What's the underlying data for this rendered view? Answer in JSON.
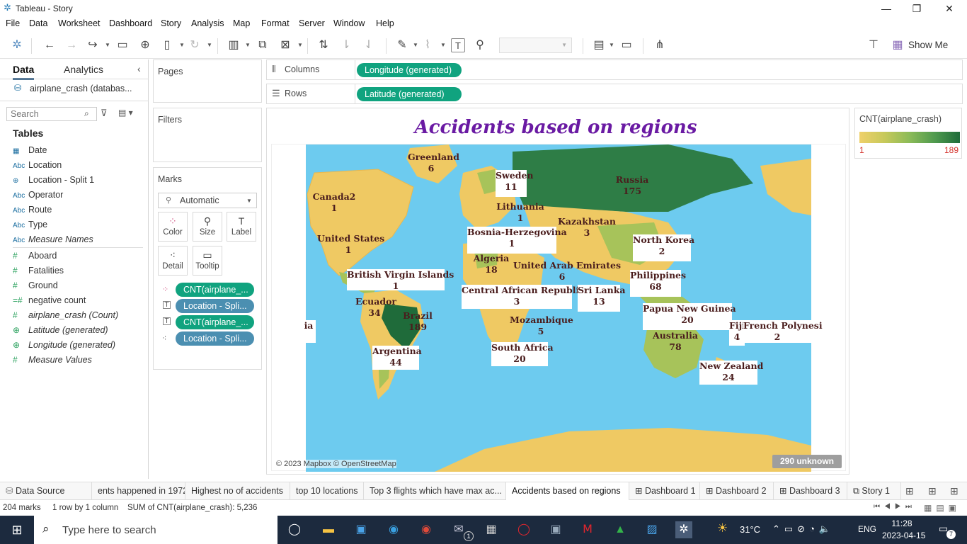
{
  "window": {
    "title": "Tableau - Story",
    "minimize": "—",
    "restore": "❐",
    "close": "✕"
  },
  "menu": [
    "File",
    "Data",
    "Worksheet",
    "Dashboard",
    "Story",
    "Analysis",
    "Map",
    "Format",
    "Server",
    "Window",
    "Help"
  ],
  "toolbar": {
    "show_me": "Show Me"
  },
  "left_pane": {
    "tab_data": "Data",
    "tab_analytics": "Analytics",
    "datasource": "airplane_crash (databas...",
    "search_placeholder": "Search",
    "tables_header": "Tables",
    "fields": [
      {
        "icon": "date",
        "label": "Date",
        "italic": false
      },
      {
        "icon": "Abc",
        "label": "Location",
        "italic": false
      },
      {
        "icon": "geo",
        "label": "Location - Split 1",
        "italic": false
      },
      {
        "icon": "Abc",
        "label": "Operator",
        "italic": false
      },
      {
        "icon": "Abc",
        "label": "Route",
        "italic": false
      },
      {
        "icon": "Abc",
        "label": "Type",
        "italic": false
      },
      {
        "icon": "Abc",
        "label": "Measure Names",
        "italic": true
      },
      {
        "icon": "#",
        "label": "Aboard",
        "italic": false
      },
      {
        "icon": "#",
        "label": "Fatalities",
        "italic": false
      },
      {
        "icon": "#",
        "label": "Ground",
        "italic": false
      },
      {
        "icon": "=#",
        "label": "negative count",
        "italic": false
      },
      {
        "icon": "#",
        "label": "airplane_crash (Count)",
        "italic": true
      },
      {
        "icon": "globe",
        "label": "Latitude (generated)",
        "italic": true
      },
      {
        "icon": "globe",
        "label": "Longitude (generated)",
        "italic": true
      },
      {
        "icon": "#",
        "label": "Measure Values",
        "italic": true
      }
    ]
  },
  "shelves": {
    "pages": "Pages",
    "filters": "Filters",
    "marks": "Marks",
    "mark_type": "Automatic",
    "mark_buttons": [
      "Color",
      "Size",
      "Label",
      "Detail",
      "Tooltip"
    ],
    "mark_pills": [
      "CNT(airplane_...",
      "Location - Spli...",
      "CNT(airplane_...",
      "Location - Spli..."
    ],
    "columns_label": "Columns",
    "rows_label": "Rows",
    "columns_pill": "Longitude (generated)",
    "rows_pill": "Latitude (generated)"
  },
  "view": {
    "title": "Accidents based on regions",
    "copyright": "© 2023 Mapbox © OpenStreetMap",
    "unknown": "290 unknown"
  },
  "map_labels": [
    {
      "name": "Greenland",
      "count": "6"
    },
    {
      "name": "Sweden",
      "count": "11"
    },
    {
      "name": "Russia",
      "count": "175"
    },
    {
      "name": "Canada2",
      "count": "1"
    },
    {
      "name": "Lithuania",
      "count": "1"
    },
    {
      "name": "Kazakhstan",
      "count": "3"
    },
    {
      "name": "Bosnia-Herzegovina",
      "count": "1"
    },
    {
      "name": "North Korea",
      "count": "2"
    },
    {
      "name": "United States",
      "count": "1"
    },
    {
      "name": "Algeria",
      "count": "18"
    },
    {
      "name": "United Arab Emirates",
      "count": "6"
    },
    {
      "name": "British Virgin Islands",
      "count": "1"
    },
    {
      "name": "Philippines",
      "count": "68"
    },
    {
      "name": "Central African Republic",
      "count": "3"
    },
    {
      "name": "Sri Lanka",
      "count": "13"
    },
    {
      "name": "Ecuador",
      "count": "34"
    },
    {
      "name": "Brazil",
      "count": "189"
    },
    {
      "name": "Papua New Guinea",
      "count": "20"
    },
    {
      "name": "ia",
      "count": ""
    },
    {
      "name": "Mozambique",
      "count": "5"
    },
    {
      "name": "Fiji",
      "count": "4"
    },
    {
      "name": "French Polynesi",
      "count": "2"
    },
    {
      "name": "Australia",
      "count": "78"
    },
    {
      "name": "Argentina",
      "count": "44"
    },
    {
      "name": "South Africa",
      "count": "20"
    },
    {
      "name": "New Zealand",
      "count": "24"
    }
  ],
  "legend": {
    "title": "CNT(airplane_crash)",
    "min": "1",
    "max": "189",
    "low_color": "#efd06a",
    "high_color": "#1f6b3a"
  },
  "colors": {
    "water": "#6dcbef",
    "land_low": "#efc963",
    "land_mid": "#a7c35a",
    "land_high": "#2e7d46",
    "accent": "#10a37f"
  },
  "sheet_tabs": [
    "Data Source",
    "ents happened in 1972",
    "Highest no of accidents",
    "top 10 locations",
    "Top 3 flights which have max ac...",
    "Accidents based on regions",
    "Dashboard 1",
    "Dashboard 2",
    "Dashboard 3",
    "Story 1"
  ],
  "status": {
    "marks": "204 marks",
    "rows": "1 row by 1 column",
    "sum": "SUM of CNT(airplane_crash): 5,236"
  },
  "taskbar": {
    "search_placeholder": "Type here to search",
    "temperature": "31°C",
    "lang": "ENG",
    "time": "11:28",
    "date": "2023-04-15",
    "notifications": "7",
    "mail_badge": "1"
  }
}
